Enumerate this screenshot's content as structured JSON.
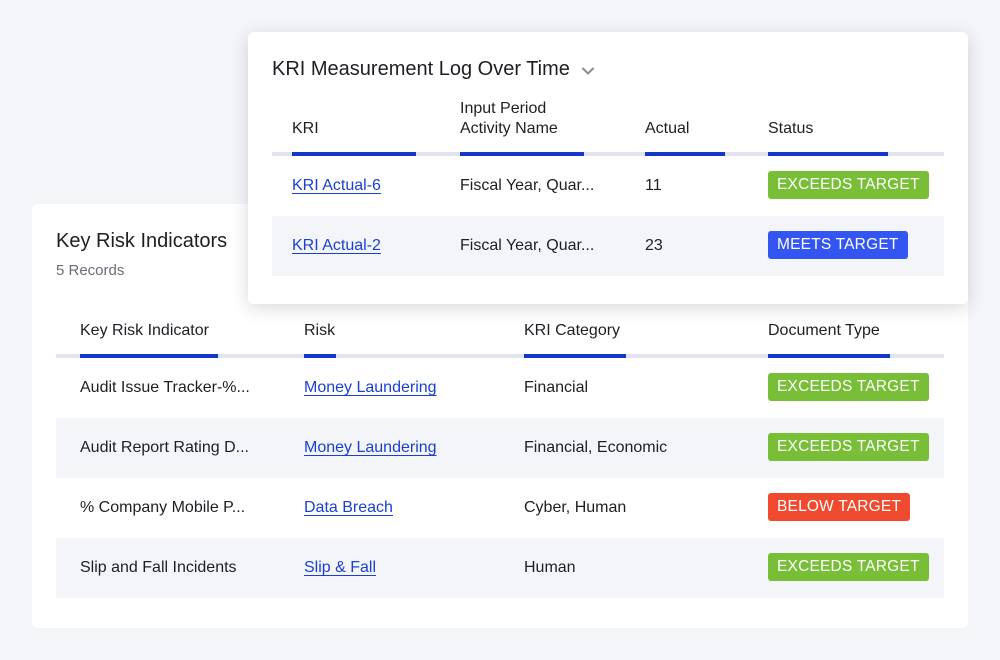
{
  "kri_table": {
    "title": "Key Risk Indicators",
    "subtitle": "5 Records",
    "columns": [
      "Key Risk Indicator",
      "Risk",
      "KRI Category",
      "Document Type"
    ],
    "rows": [
      {
        "indicator": "Audit Issue Tracker-%...",
        "risk": "Money Laundering",
        "category": "Financial",
        "status": "EXCEEDS TARGET"
      },
      {
        "indicator": "Audit Report Rating D...",
        "risk": "Money Laundering",
        "category": "Financial, Economic",
        "status": "EXCEEDS TARGET"
      },
      {
        "indicator": "% Company Mobile P...",
        "risk": "Data Breach",
        "category": "Cyber, Human",
        "status": "BELOW TARGET"
      },
      {
        "indicator": "Slip and Fall Incidents",
        "risk": "Slip & Fall",
        "category": "Human",
        "status": "EXCEEDS TARGET"
      }
    ]
  },
  "log_table": {
    "title": "KRI Measurement Log Over Time",
    "dropdown_icon": "chevron-down-icon",
    "columns": [
      "KRI",
      "Input Period\nActivity Name",
      "Actual",
      "Status"
    ],
    "rows": [
      {
        "kri": "KRI Actual-6",
        "period": "Fiscal Year, Quar...",
        "actual": "11",
        "status": "EXCEEDS TARGET"
      },
      {
        "kri": "KRI Actual-2",
        "period": "Fiscal Year, Quar...",
        "actual": "23",
        "status": "MEETS TARGET"
      }
    ]
  },
  "colors": {
    "accent": "#1437c9",
    "link": "#1a3fd6",
    "exceeds": "#78bf37",
    "meets": "#3355f2",
    "below": "#f04a2e"
  }
}
